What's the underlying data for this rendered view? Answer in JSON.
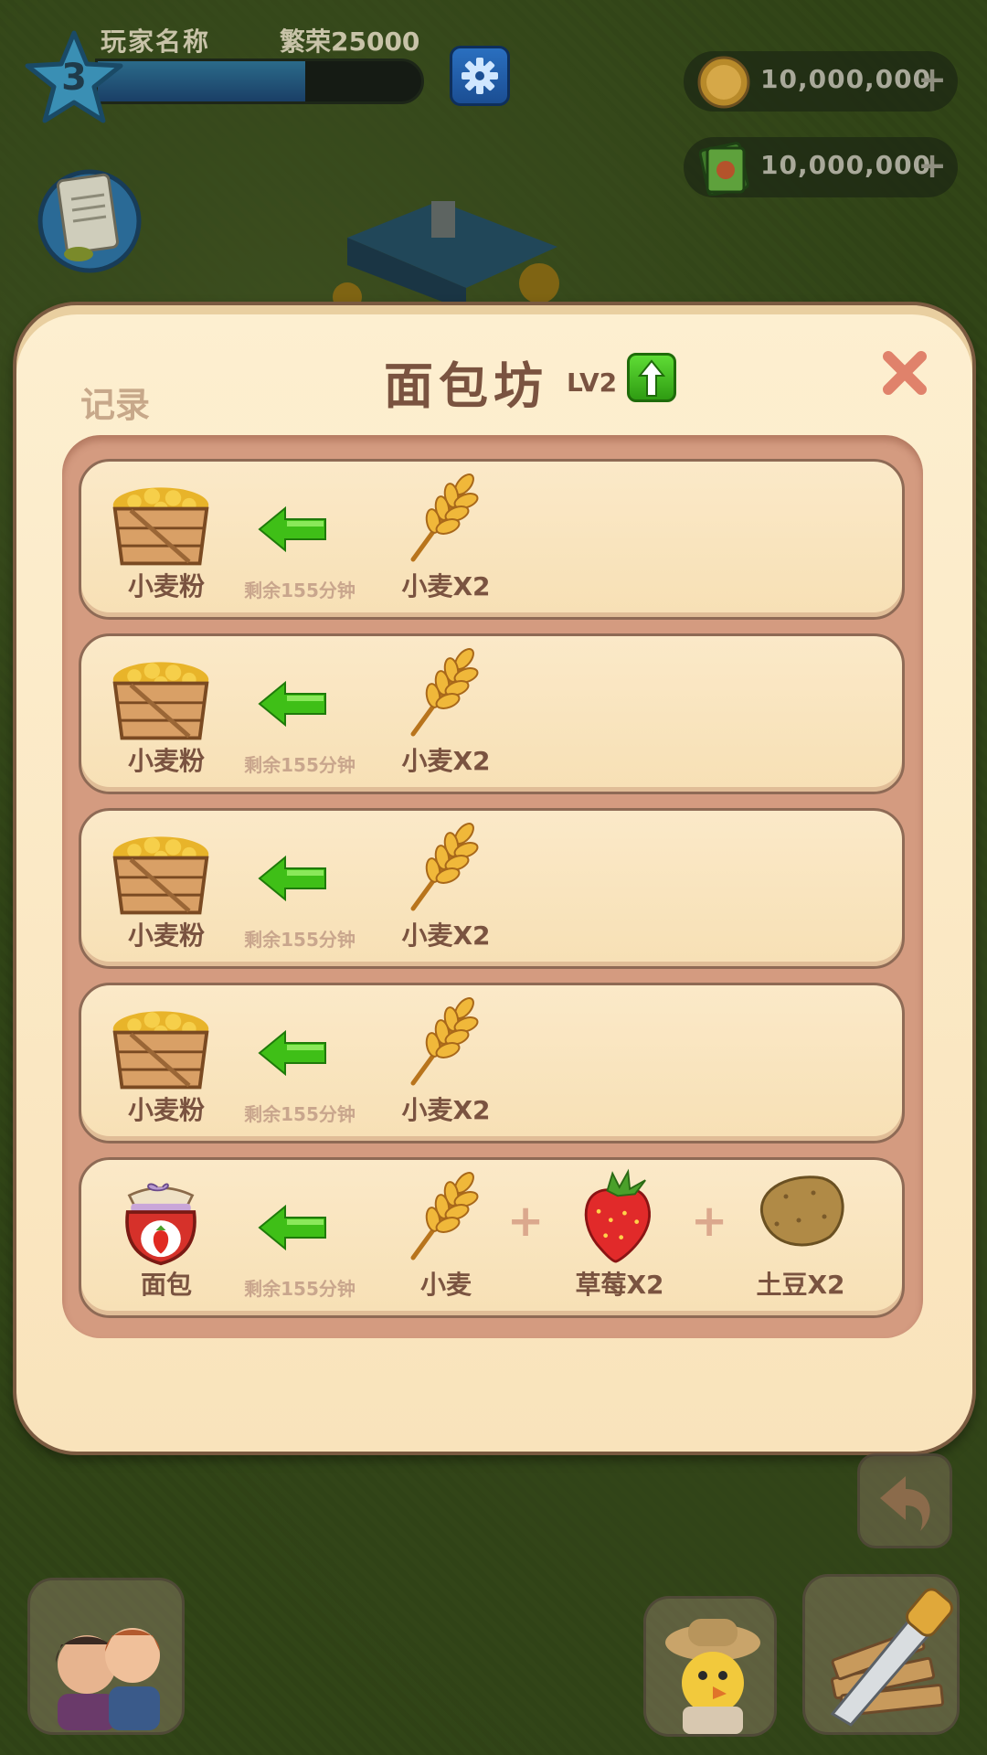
{
  "hud": {
    "player_name": "玩家名称",
    "prosperity": "繁荣25000",
    "level": "3",
    "xp_fraction": 0.64,
    "coins": "10,000,000",
    "cash": "10,000,000",
    "plus_symbol": "+"
  },
  "dialog": {
    "record_label": "记录",
    "title": "面包坊",
    "level": "LV2"
  },
  "queue": [
    {
      "product": "小麦粉",
      "product_icon": "flour-crate-icon",
      "time_left": "剩余155分钟",
      "ingredients": [
        {
          "label": "小麦X2",
          "icon": "wheat-icon"
        }
      ]
    },
    {
      "product": "小麦粉",
      "product_icon": "flour-crate-icon",
      "time_left": "剩余155分钟",
      "ingredients": [
        {
          "label": "小麦X2",
          "icon": "wheat-icon"
        }
      ]
    },
    {
      "product": "小麦粉",
      "product_icon": "flour-crate-icon",
      "time_left": "剩余155分钟",
      "ingredients": [
        {
          "label": "小麦X2",
          "icon": "wheat-icon"
        }
      ]
    },
    {
      "product": "小麦粉",
      "product_icon": "flour-crate-icon",
      "time_left": "剩余155分钟",
      "ingredients": [
        {
          "label": "小麦X2",
          "icon": "wheat-icon"
        }
      ]
    },
    {
      "product": "面包",
      "product_icon": "strawberry-jam-jar-icon",
      "time_left": "剩余155分钟",
      "ingredients": [
        {
          "label": "小麦",
          "icon": "wheat-icon"
        },
        {
          "label": "草莓X2",
          "icon": "strawberry-icon"
        },
        {
          "label": "土豆X2",
          "icon": "potato-icon"
        }
      ]
    }
  ],
  "colors": {
    "panel_cream": "#fbe9c8",
    "panel_border": "#7a5a40",
    "text_brown": "#7a5340",
    "arrow_green": "#3fbf17"
  }
}
